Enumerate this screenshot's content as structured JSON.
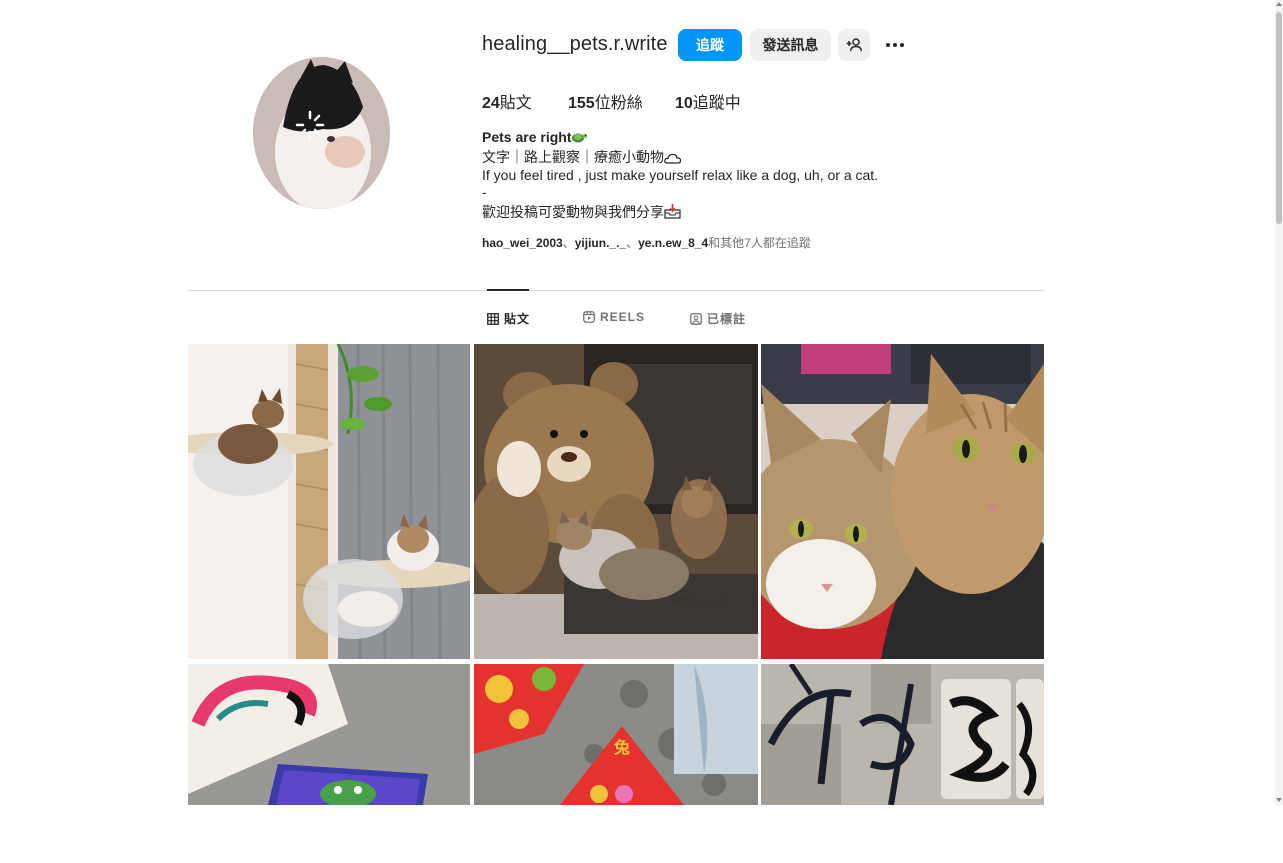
{
  "profile": {
    "username": "healing__pets.r.write",
    "follow_label": "追蹤",
    "message_label": "發送訊息",
    "stats": {
      "posts_count": "24",
      "posts_label": "貼文",
      "followers_count": "155",
      "followers_label": "位粉絲",
      "following_count": "10",
      "following_label": "追蹤中"
    },
    "bio": {
      "name": "Pets are right",
      "line1": "文字｜路上觀察｜療癒小動物",
      "line2": "If you feel tired , just make yourself relax like a dog, uh, or a cat.",
      "line3": "-",
      "line4": "歡迎投稿可愛動物與我們分享"
    },
    "followed_by": {
      "user1": "hao_wei_2003",
      "sep1": "、",
      "user2": "yijiun._._",
      "sep2": "、",
      "user3": "ye.n.ew_8_4",
      "suffix": "和其他7人都在追蹤"
    }
  },
  "tabs": [
    {
      "label": "貼文",
      "icon": "grid-icon",
      "active": true
    },
    {
      "label": "REELS",
      "icon": "reels-icon",
      "active": false
    },
    {
      "label": "已標註",
      "icon": "tagged-icon",
      "active": false
    }
  ],
  "posts": [
    {
      "name": "cats-on-cat-tree"
    },
    {
      "name": "cats-with-teddy-bear"
    },
    {
      "name": "two-cats-closeup"
    },
    {
      "name": "graffiti-sticker-wall"
    },
    {
      "name": "spring-couplet-wall"
    },
    {
      "name": "graffiti-tag-wall"
    }
  ],
  "colors": {
    "accent": "#0095f6",
    "button_gray": "#efefef",
    "text_primary": "#262626",
    "text_secondary": "#737373",
    "divider": "#dbdbdb"
  }
}
